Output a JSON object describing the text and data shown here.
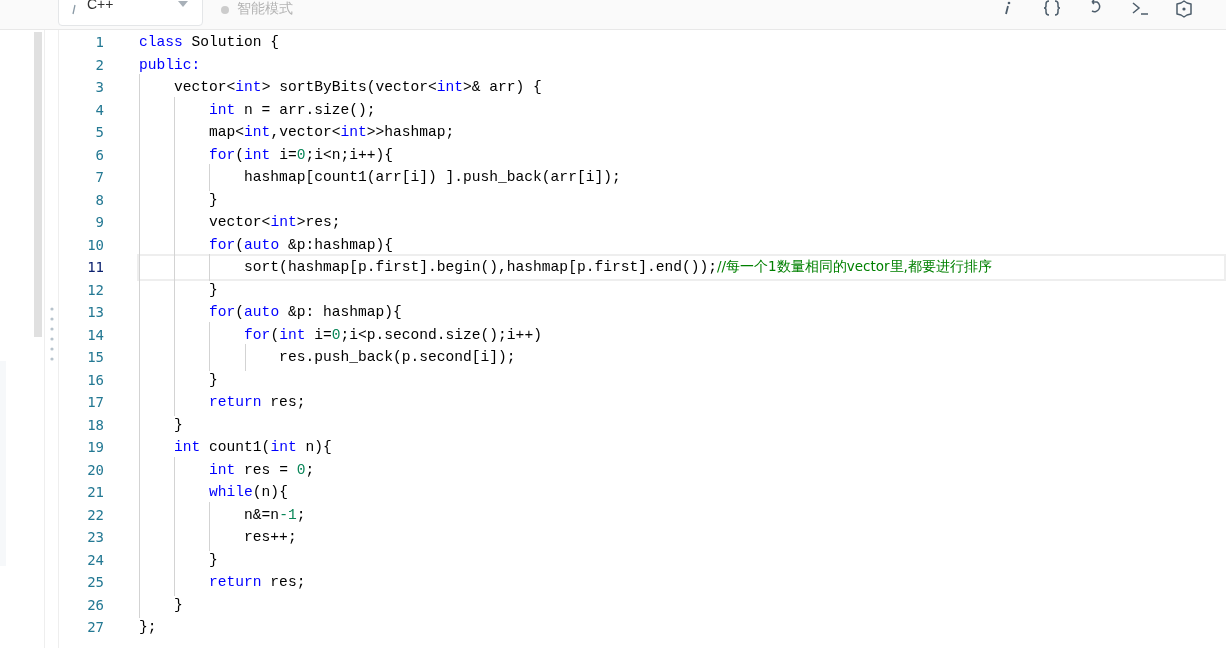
{
  "toolbar": {
    "language": "C++",
    "mode": "智能模式",
    "actions": [
      {
        "kind": "info"
      },
      {
        "kind": "braces"
      },
      {
        "kind": "reset"
      },
      {
        "kind": "terminal"
      },
      {
        "kind": "settings"
      }
    ]
  },
  "editor": {
    "lines": [
      {
        "number": "1",
        "selected": false,
        "tokens": [
          {
            "kind": "keyword",
            "text": "class"
          },
          {
            "kind": "plain",
            "text": " Solution {"
          }
        ]
      },
      {
        "number": "2",
        "selected": false,
        "tokens": [
          {
            "kind": "keyword",
            "text": "public:"
          }
        ]
      },
      {
        "number": "3",
        "selected": false,
        "tokens": [
          {
            "kind": "plain",
            "text": "    vector<"
          },
          {
            "kind": "keyword",
            "text": "int"
          },
          {
            "kind": "plain",
            "text": "> sortByBits(vector<"
          },
          {
            "kind": "keyword",
            "text": "int"
          },
          {
            "kind": "plain",
            "text": ">& arr) {"
          }
        ]
      },
      {
        "number": "4",
        "selected": false,
        "tokens": [
          {
            "kind": "keyword",
            "text": "        int"
          },
          {
            "kind": "plain",
            "text": " n = arr.size();"
          }
        ]
      },
      {
        "number": "5",
        "selected": false,
        "tokens": [
          {
            "kind": "plain",
            "text": "        map<"
          },
          {
            "kind": "keyword",
            "text": "int"
          },
          {
            "kind": "plain",
            "text": ",vector<"
          },
          {
            "kind": "keyword",
            "text": "int"
          },
          {
            "kind": "plain",
            "text": ">>hashmap;"
          }
        ]
      },
      {
        "number": "6",
        "selected": false,
        "tokens": [
          {
            "kind": "keyword",
            "text": "        for"
          },
          {
            "kind": "plain",
            "text": "("
          },
          {
            "kind": "keyword",
            "text": "int"
          },
          {
            "kind": "plain",
            "text": " i="
          },
          {
            "kind": "number",
            "text": "0"
          },
          {
            "kind": "plain",
            "text": ";i<n;i++){"
          }
        ]
      },
      {
        "number": "7",
        "selected": false,
        "tokens": [
          {
            "kind": "plain",
            "text": "            hashmap[count1(arr[i]) ].push_back(arr[i]);"
          }
        ]
      },
      {
        "number": "8",
        "selected": false,
        "tokens": [
          {
            "kind": "plain",
            "text": "        }"
          }
        ]
      },
      {
        "number": "9",
        "selected": false,
        "tokens": [
          {
            "kind": "plain",
            "text": "        vector<"
          },
          {
            "kind": "keyword",
            "text": "int"
          },
          {
            "kind": "plain",
            "text": ">res;"
          }
        ]
      },
      {
        "number": "10",
        "selected": false,
        "tokens": [
          {
            "kind": "keyword",
            "text": "        for"
          },
          {
            "kind": "plain",
            "text": "("
          },
          {
            "kind": "keyword",
            "text": "auto"
          },
          {
            "kind": "plain",
            "text": " &p:hashmap){"
          }
        ]
      },
      {
        "number": "11",
        "selected": true,
        "tokens": [
          {
            "kind": "plain",
            "text": "            sort(hashmap[p.first].begin(),hashmap[p.first].end());"
          },
          {
            "kind": "comment",
            "text": "//每一个1数量相同的vector里,都要进行排序"
          }
        ]
      },
      {
        "number": "12",
        "selected": false,
        "tokens": [
          {
            "kind": "plain",
            "text": "        }"
          }
        ]
      },
      {
        "number": "13",
        "selected": false,
        "tokens": [
          {
            "kind": "keyword",
            "text": "        for"
          },
          {
            "kind": "plain",
            "text": "("
          },
          {
            "kind": "keyword",
            "text": "auto"
          },
          {
            "kind": "plain",
            "text": " &p: hashmap){"
          }
        ]
      },
      {
        "number": "14",
        "selected": false,
        "tokens": [
          {
            "kind": "keyword",
            "text": "            for"
          },
          {
            "kind": "plain",
            "text": "("
          },
          {
            "kind": "keyword",
            "text": "int"
          },
          {
            "kind": "plain",
            "text": " i="
          },
          {
            "kind": "number",
            "text": "0"
          },
          {
            "kind": "plain",
            "text": ";i<p.second.size();i++)"
          }
        ]
      },
      {
        "number": "15",
        "selected": false,
        "tokens": [
          {
            "kind": "plain",
            "text": "                res.push_back(p.second[i]);"
          }
        ]
      },
      {
        "number": "16",
        "selected": false,
        "tokens": [
          {
            "kind": "plain",
            "text": "        }"
          }
        ]
      },
      {
        "number": "17",
        "selected": false,
        "tokens": [
          {
            "kind": "keyword",
            "text": "        return"
          },
          {
            "kind": "plain",
            "text": " res;"
          }
        ]
      },
      {
        "number": "18",
        "selected": false,
        "tokens": [
          {
            "kind": "plain",
            "text": "    }"
          }
        ]
      },
      {
        "number": "19",
        "selected": false,
        "tokens": [
          {
            "kind": "keyword",
            "text": "    int"
          },
          {
            "kind": "plain",
            "text": " count1("
          },
          {
            "kind": "keyword",
            "text": "int"
          },
          {
            "kind": "plain",
            "text": " n){"
          }
        ]
      },
      {
        "number": "20",
        "selected": false,
        "tokens": [
          {
            "kind": "keyword",
            "text": "        int"
          },
          {
            "kind": "plain",
            "text": " res = "
          },
          {
            "kind": "number",
            "text": "0"
          },
          {
            "kind": "plain",
            "text": ";"
          }
        ]
      },
      {
        "number": "21",
        "selected": false,
        "tokens": [
          {
            "kind": "keyword",
            "text": "        while"
          },
          {
            "kind": "plain",
            "text": "(n){"
          }
        ]
      },
      {
        "number": "22",
        "selected": false,
        "tokens": [
          {
            "kind": "plain",
            "text": "            n&=n"
          },
          {
            "kind": "number",
            "text": "-1"
          },
          {
            "kind": "plain",
            "text": ";"
          }
        ]
      },
      {
        "number": "23",
        "selected": false,
        "tokens": [
          {
            "kind": "plain",
            "text": "            res++;"
          }
        ]
      },
      {
        "number": "24",
        "selected": false,
        "tokens": [
          {
            "kind": "plain",
            "text": "        }"
          }
        ]
      },
      {
        "number": "25",
        "selected": false,
        "tokens": [
          {
            "kind": "keyword",
            "text": "        return"
          },
          {
            "kind": "plain",
            "text": " res;"
          }
        ]
      },
      {
        "number": "26",
        "selected": false,
        "tokens": [
          {
            "kind": "plain",
            "text": "    }"
          }
        ]
      },
      {
        "number": "27",
        "selected": false,
        "tokens": [
          {
            "kind": "plain",
            "text": "};"
          }
        ]
      }
    ]
  }
}
